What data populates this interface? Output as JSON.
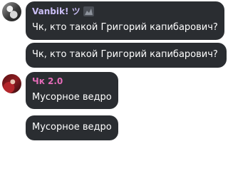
{
  "messages": [
    {
      "author": "Vanbik! ツ",
      "text": "Чк, кто такой Григорий капибарович?",
      "author_color": "#cabef5",
      "badge_icon": "character-badge-icon"
    },
    {
      "author": "",
      "text": "Чк, кто такой Григорий капибарович?"
    },
    {
      "author": "Чк 2.0",
      "text": "Мусорное ведро",
      "author_color": "#e46bb8"
    },
    {
      "author": "",
      "text": "Мусорное ведро"
    }
  ],
  "colors": {
    "bubble_background": "#2a2d31",
    "message_text": "#ffffff",
    "page_background": "#ffffff"
  }
}
